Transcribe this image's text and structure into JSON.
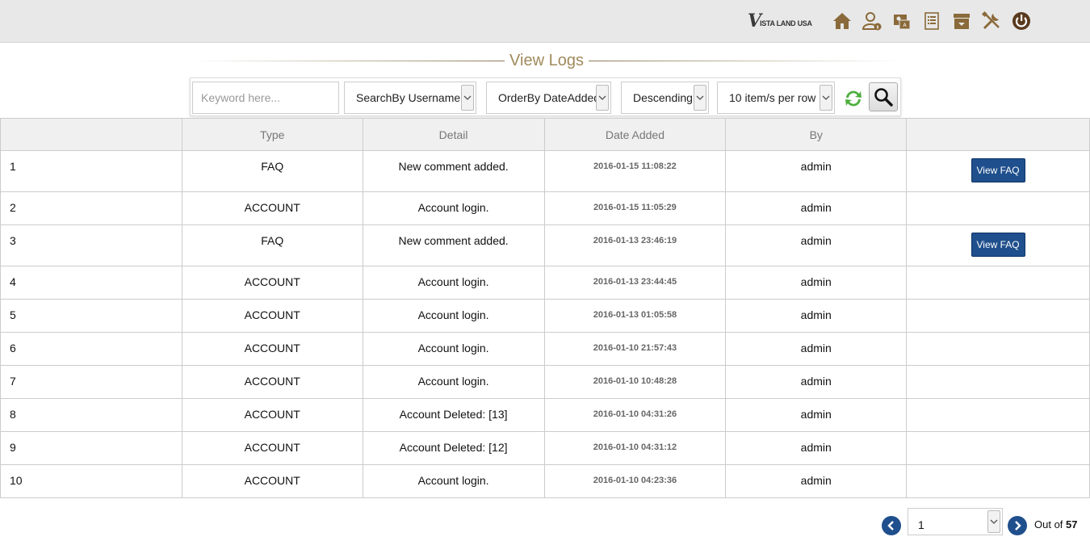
{
  "brand": {
    "mark": "V",
    "name": "ISTA LAND USA"
  },
  "nav": {
    "icons": [
      "home-icon",
      "user-info-icon",
      "contacts-icon",
      "list-icon",
      "archive-icon",
      "settings-icon",
      "power-icon"
    ]
  },
  "page": {
    "title": "View Logs"
  },
  "filters": {
    "keyword_placeholder": "Keyword here...",
    "search_by": "SearchBy Username",
    "order_by": "OrderBy DateAdded",
    "direction": "Descending",
    "per_row": "10 item/s per row"
  },
  "table": {
    "headers": [
      "",
      "Type",
      "Detail",
      "Date Added",
      "By",
      ""
    ],
    "rows": [
      {
        "num": "1",
        "type": "FAQ",
        "detail": "New comment added.",
        "date": "2016-01-15 11:08:22",
        "by": "admin",
        "action": "View FAQ"
      },
      {
        "num": "2",
        "type": "ACCOUNT",
        "detail": "Account login.",
        "date": "2016-01-15 11:05:29",
        "by": "admin",
        "action": ""
      },
      {
        "num": "3",
        "type": "FAQ",
        "detail": "New comment added.",
        "date": "2016-01-13 23:46:19",
        "by": "admin",
        "action": "View FAQ"
      },
      {
        "num": "4",
        "type": "ACCOUNT",
        "detail": "Account login.",
        "date": "2016-01-13 23:44:45",
        "by": "admin",
        "action": ""
      },
      {
        "num": "5",
        "type": "ACCOUNT",
        "detail": "Account login.",
        "date": "2016-01-13 01:05:58",
        "by": "admin",
        "action": ""
      },
      {
        "num": "6",
        "type": "ACCOUNT",
        "detail": "Account login.",
        "date": "2016-01-10 21:57:43",
        "by": "admin",
        "action": ""
      },
      {
        "num": "7",
        "type": "ACCOUNT",
        "detail": "Account login.",
        "date": "2016-01-10 10:48:28",
        "by": "admin",
        "action": ""
      },
      {
        "num": "8",
        "type": "ACCOUNT",
        "detail": "Account Deleted: [13]",
        "date": "2016-01-10 04:31:26",
        "by": "admin",
        "action": ""
      },
      {
        "num": "9",
        "type": "ACCOUNT",
        "detail": "Account Deleted: [12]",
        "date": "2016-01-10 04:31:12",
        "by": "admin",
        "action": ""
      },
      {
        "num": "10",
        "type": "ACCOUNT",
        "detail": "Account login.",
        "date": "2016-01-10 04:23:36",
        "by": "admin",
        "action": ""
      }
    ]
  },
  "pager": {
    "current": "1",
    "out_of_label": "Out of",
    "total": "57"
  },
  "colors": {
    "accent": "#a08a5c",
    "button": "#1f4f8c",
    "icon": "#8a6a3a"
  }
}
